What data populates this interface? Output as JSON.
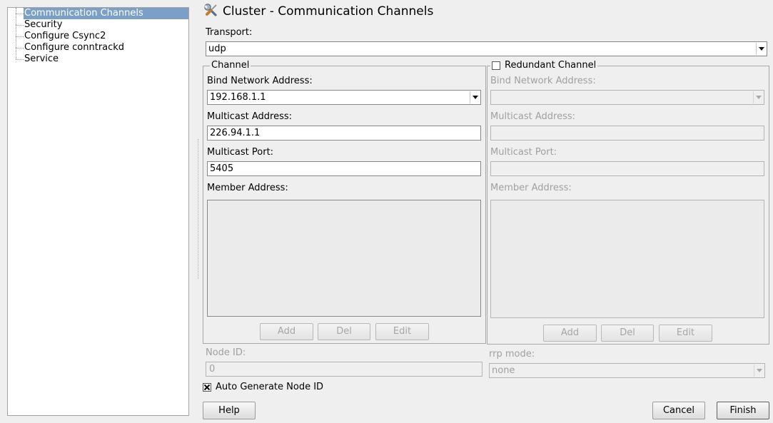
{
  "colors": {
    "selection_bg": "#7b9fc6",
    "selection_text": "#ffffff",
    "window_bg": "#efefef",
    "disabled_text": "#a0a0a0"
  },
  "sidebar": {
    "items": [
      {
        "label": "Communication Channels",
        "selected": true
      },
      {
        "label": "Security",
        "selected": false
      },
      {
        "label": "Configure Csync2",
        "selected": false
      },
      {
        "label": "Configure conntrackd",
        "selected": false
      },
      {
        "label": "Service",
        "selected": false
      }
    ]
  },
  "header": {
    "icon": "wrench-screwdriver-icon",
    "title": "Cluster - Communication Channels"
  },
  "transport": {
    "label": "Transport:",
    "value": "udp"
  },
  "channel": {
    "legend": "Channel",
    "bind_network_address": {
      "label": "Bind Network Address:",
      "value": "192.168.1.1"
    },
    "multicast_address": {
      "label": "Multicast Address:",
      "value": "226.94.1.1"
    },
    "multicast_port": {
      "label": "Multicast Port:",
      "value": "5405"
    },
    "member_address": {
      "label": "Member Address:",
      "items": []
    },
    "buttons": {
      "add": "Add",
      "del": "Del",
      "edit": "Edit",
      "disabled": true
    }
  },
  "redundant_channel": {
    "legend": "Redundant Channel",
    "enabled": false,
    "bind_network_address": {
      "label": "Bind Network Address:",
      "value": ""
    },
    "multicast_address": {
      "label": "Multicast Address:",
      "value": ""
    },
    "multicast_port": {
      "label": "Multicast Port:",
      "value": ""
    },
    "member_address": {
      "label": "Member Address:",
      "items": []
    },
    "buttons": {
      "add": "Add",
      "del": "Del",
      "edit": "Edit",
      "disabled": true
    }
  },
  "node_id": {
    "label": "Node ID:",
    "value": "0",
    "disabled": true
  },
  "rrp_mode": {
    "label": "rrp mode:",
    "value": "none",
    "disabled": true
  },
  "auto_generate_node_id": {
    "label": "Auto Generate Node ID",
    "checked": true
  },
  "footer": {
    "help": "Help",
    "cancel": "Cancel",
    "finish": "Finish"
  }
}
